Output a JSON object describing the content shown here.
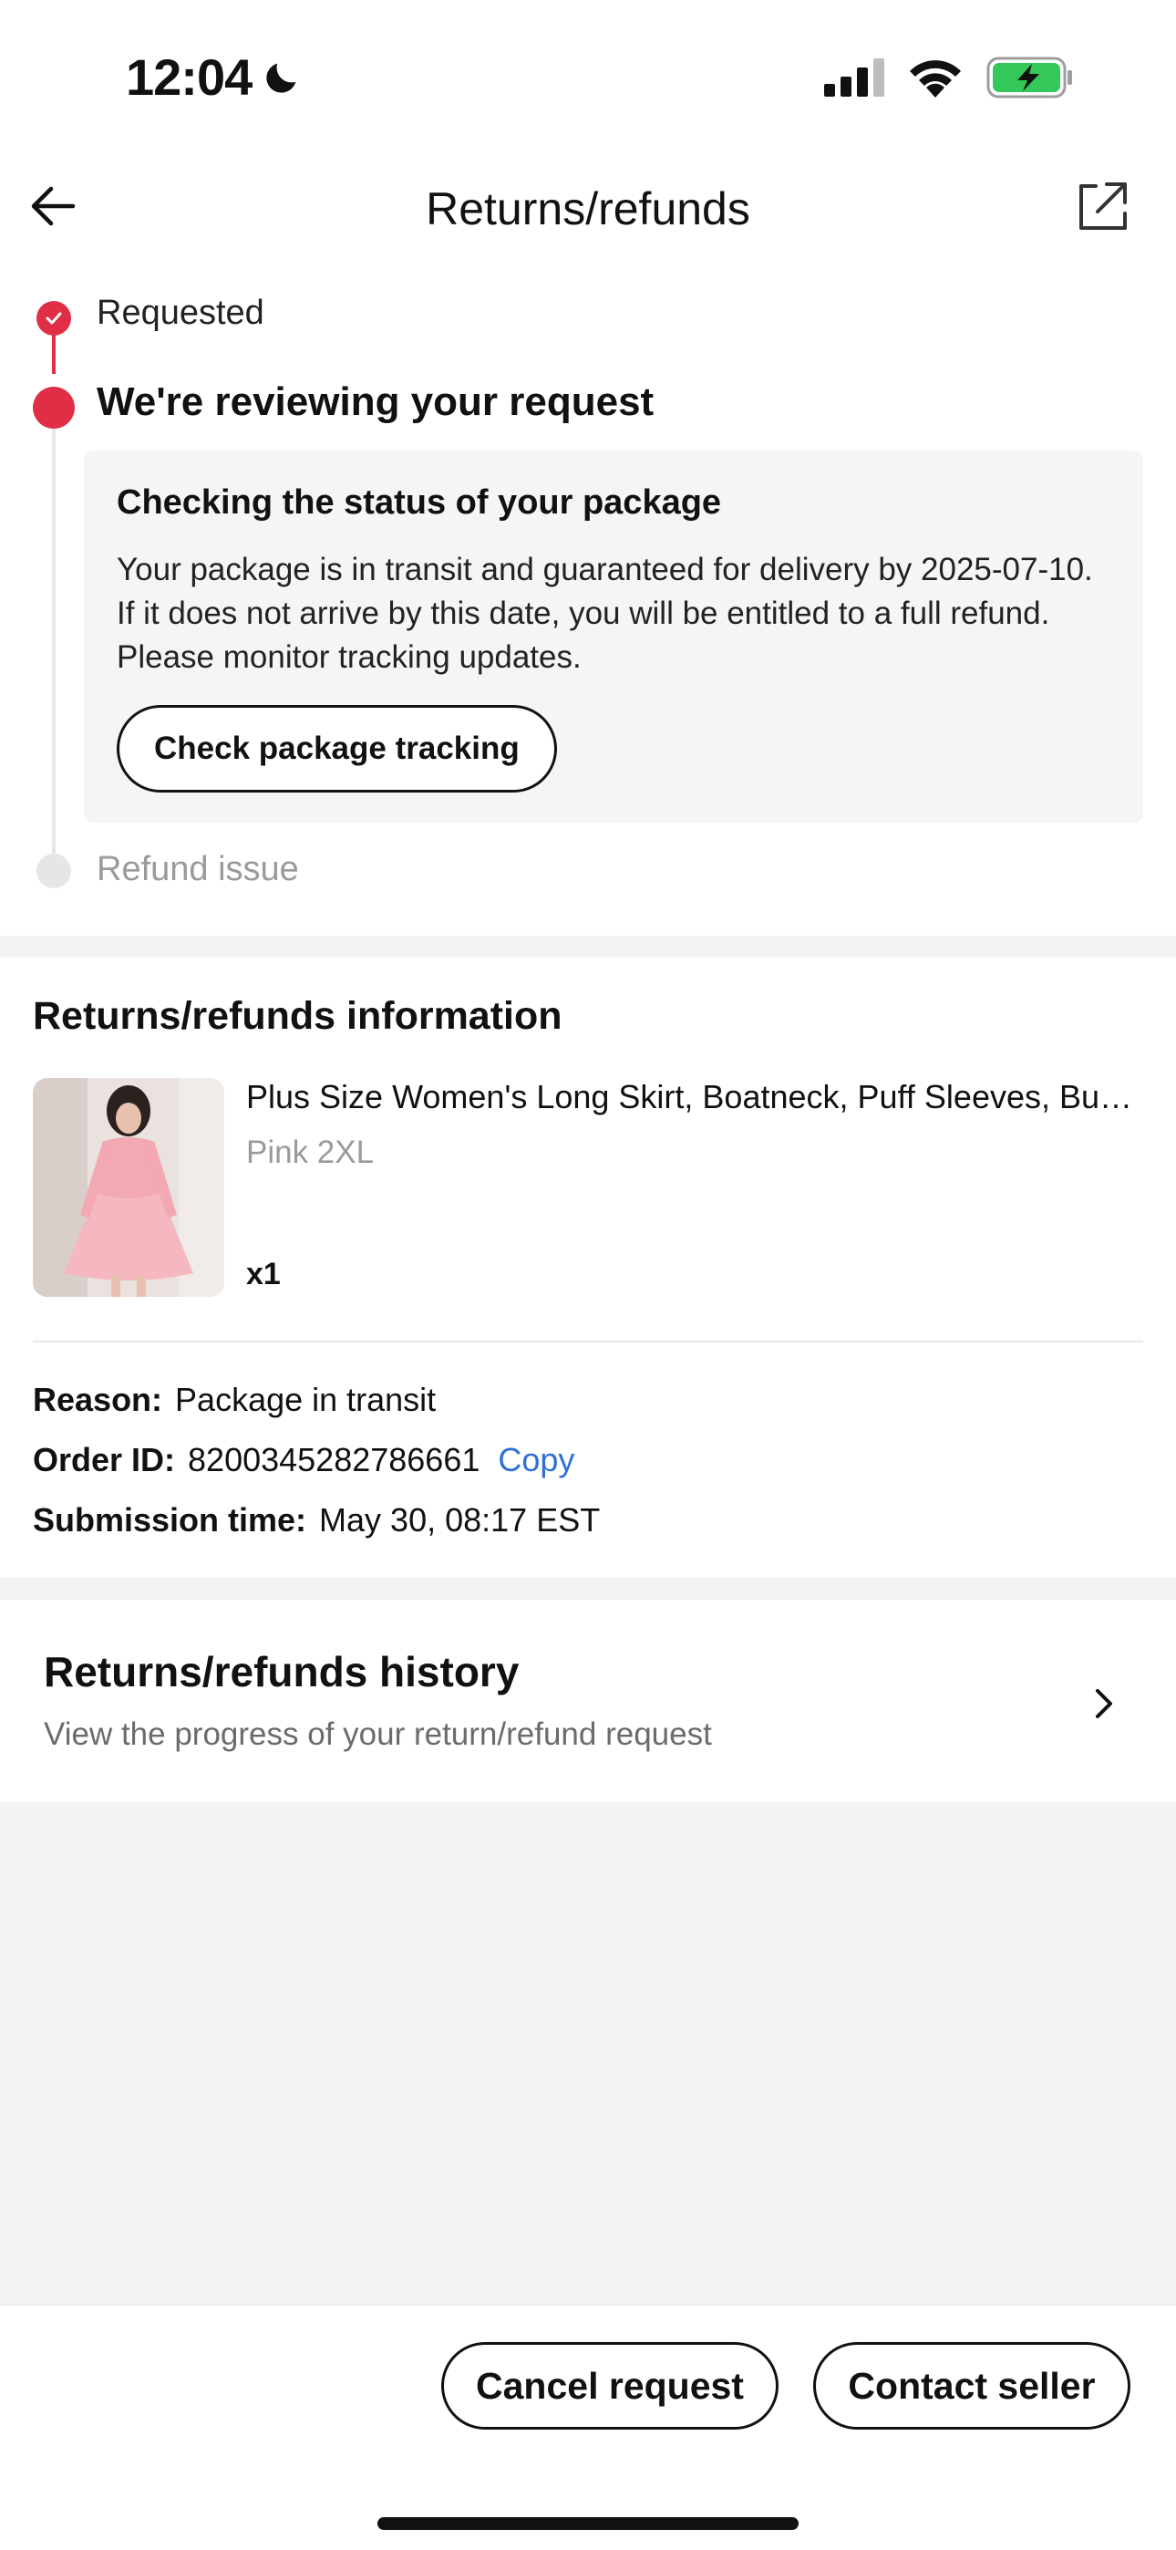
{
  "status_bar": {
    "time": "12:04",
    "icons": [
      "moon-icon",
      "cellular-signal-icon",
      "wifi-icon",
      "battery-charging-icon"
    ]
  },
  "nav": {
    "title": "Returns/refunds",
    "back_icon": "arrow-left-icon",
    "share_icon": "share-icon"
  },
  "timeline": {
    "steps": [
      {
        "label": "Requested",
        "state": "done"
      },
      {
        "label": "We're reviewing your request",
        "state": "current"
      },
      {
        "label": "Refund issue",
        "state": "pending"
      }
    ],
    "card": {
      "title": "Checking the status of your package",
      "body": "Your package is in transit and guaranteed for delivery by 2025-07-10. If it does not arrive by this date, you will be entitled to a full refund. Please monitor tracking updates.",
      "button_label": "Check package tracking"
    }
  },
  "info": {
    "title": "Returns/refunds information",
    "product": {
      "name": "Plus Size Women's Long Skirt, Boatneck, Puff Sleeves, Button Front",
      "variant": "Pink 2XL",
      "quantity": "x1"
    },
    "reason_label": "Reason:",
    "reason_value": "Package in transit",
    "order_label": "Order ID:",
    "order_value": "8200345282786661",
    "copy_label": "Copy",
    "submission_label": "Submission time:",
    "submission_value": "May 30, 08:17 EST"
  },
  "history": {
    "title": "Returns/refunds history",
    "subtitle": "View the progress of your return/refund request"
  },
  "actions": {
    "cancel_label": "Cancel request",
    "contact_label": "Contact seller"
  },
  "colors": {
    "accent": "#e02e46",
    "link": "#2f6fd6",
    "battery": "#34c759"
  }
}
